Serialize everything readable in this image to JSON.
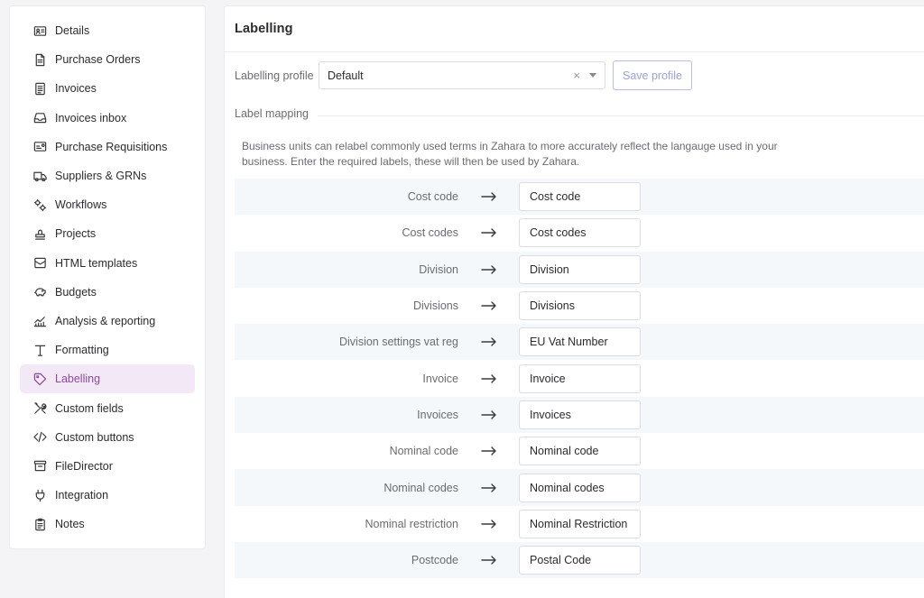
{
  "sidebar": {
    "items": [
      {
        "label": "Details",
        "icon": "id-card-icon"
      },
      {
        "label": "Purchase Orders",
        "icon": "document-icon"
      },
      {
        "label": "Invoices",
        "icon": "receipt-icon"
      },
      {
        "label": "Invoices inbox",
        "icon": "inbox-icon"
      },
      {
        "label": "Purchase Requisitions",
        "icon": "requisition-icon"
      },
      {
        "label": "Suppliers & GRNs",
        "icon": "truck-icon"
      },
      {
        "label": "Workflows",
        "icon": "cogs-icon"
      },
      {
        "label": "Projects",
        "icon": "stamp-icon"
      },
      {
        "label": "HTML templates",
        "icon": "template-icon"
      },
      {
        "label": "Budgets",
        "icon": "piggy-bank-icon"
      },
      {
        "label": "Analysis & reporting",
        "icon": "chart-icon"
      },
      {
        "label": "Formatting",
        "icon": "text-icon"
      },
      {
        "label": "Labelling",
        "icon": "tag-icon",
        "active": true
      },
      {
        "label": "Custom fields",
        "icon": "tools-icon"
      },
      {
        "label": "Custom buttons",
        "icon": "code-icon"
      },
      {
        "label": "FileDirector",
        "icon": "archive-icon"
      },
      {
        "label": "Integration",
        "icon": "plug-icon"
      },
      {
        "label": "Notes",
        "icon": "clipboard-icon"
      }
    ],
    "active_color": "#8c4a9b",
    "active_bg": "#f3e8f6"
  },
  "main": {
    "title": "Labelling",
    "profile": {
      "label": "Labelling profile",
      "value": "Default",
      "clear_symbol": "×",
      "save_label": "Save profile"
    },
    "section_title": "Label mapping",
    "description": "Business units can relabel commonly used terms in Zahara to more accurately reflect the langauge used in your business. Enter the required labels, these will then be used by Zahara.",
    "mappings": [
      {
        "source": "Cost code",
        "value": "Cost code"
      },
      {
        "source": "Cost codes",
        "value": "Cost codes"
      },
      {
        "source": "Division",
        "value": "Division"
      },
      {
        "source": "Divisions",
        "value": "Divisions"
      },
      {
        "source": "Division settings vat reg",
        "value": "EU Vat Number"
      },
      {
        "source": "Invoice",
        "value": "Invoice"
      },
      {
        "source": "Invoices",
        "value": " Invoices"
      },
      {
        "source": "Nominal code",
        "value": "Nominal code"
      },
      {
        "source": "Nominal codes",
        "value": "Nominal codes"
      },
      {
        "source": "Nominal restriction",
        "value": "Nominal Restriction"
      },
      {
        "source": "Postcode",
        "value": "Postal Code"
      }
    ]
  }
}
